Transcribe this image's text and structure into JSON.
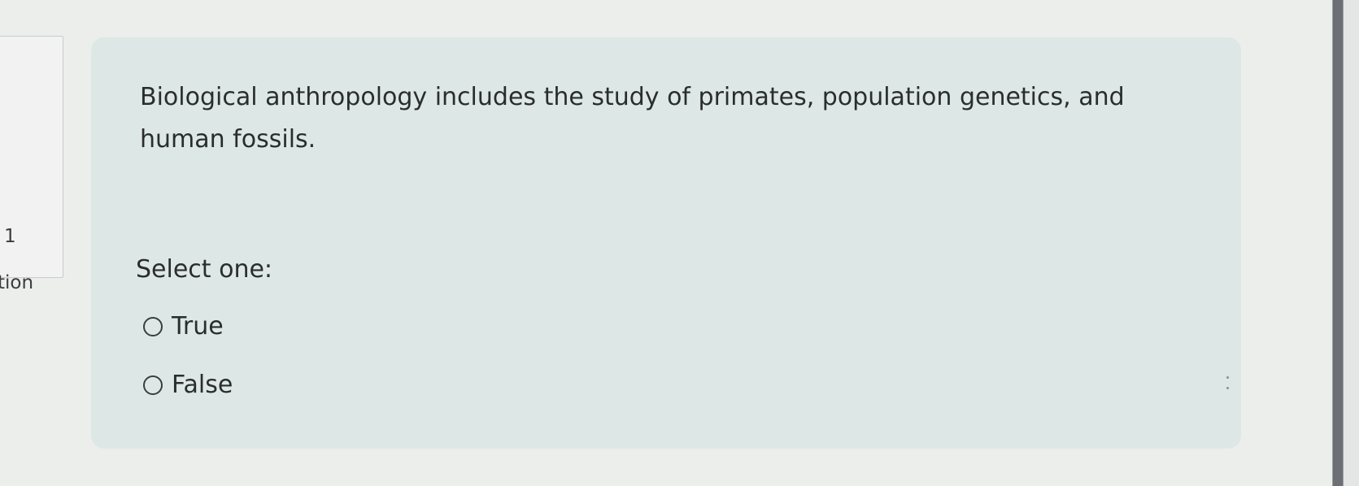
{
  "info": {
    "question_number": "1",
    "label_fragment": "tion"
  },
  "question": {
    "text": "Biological anthropology includes the study of primates, population genetics, and human fossils.",
    "prompt": "Select one:",
    "options": [
      {
        "label": "True",
        "selected": false
      },
      {
        "label": "False",
        "selected": false
      }
    ]
  },
  "colors": {
    "card_background": "#dde8e6",
    "page_background": "#eceeec",
    "text": "#2a2d2e"
  },
  "icons": {
    "radio": "radio-unchecked-icon"
  }
}
